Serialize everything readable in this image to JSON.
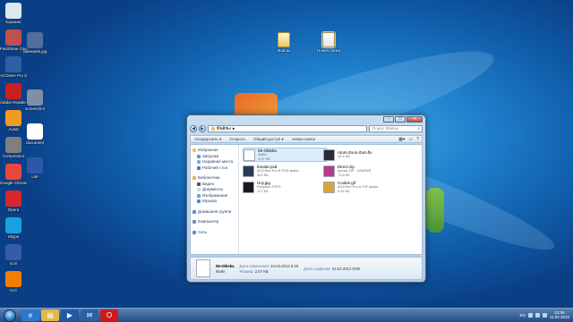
{
  "desktop_icons": [
    {
      "label": "Корзина",
      "color": "#dce7f1"
    },
    {
      "label": "FastStone Capture",
      "color": "#c0504d"
    },
    {
      "label": "ACDSee Pro 8",
      "color": "#2e5fa3"
    },
    {
      "label": "Adobe Reader XI",
      "color": "#c82020"
    },
    {
      "label": "Avast",
      "color": "#f29a1e"
    },
    {
      "label": "Compressor",
      "color": "#7f7f7f"
    },
    {
      "label": "Google Chrome",
      "color": "#e8473b"
    },
    {
      "label": "Opera",
      "color": "#d7262d"
    },
    {
      "label": "Skype",
      "color": "#1aa0e0"
    },
    {
      "label": "Icon",
      "color": "#355ba8"
    },
    {
      "label": "VLC",
      "color": "#f07f00"
    }
  ],
  "desktop_icons_col2": [
    {
      "label": "sideswitle.jpg",
      "color": "#4f6f9f"
    },
    {
      "label": "screenshot",
      "color": "#7f8fa7"
    },
    {
      "label": "document",
      "color": "#ffffff"
    },
    {
      "label": "Lite",
      "color": "#2d58a7"
    }
  ],
  "desktop_folders": [
    {
      "label": "Файлы",
      "selected": false
    },
    {
      "label": "Новая папка",
      "selected": true
    }
  ],
  "window": {
    "address": "Файлы",
    "search_placeholder": "Поиск: Файлы",
    "toolbar": [
      "Упорядочить ▾",
      "Открыть",
      "Общий доступ ▾",
      "Новая папка"
    ],
    "nav": {
      "favorites": {
        "title": "Избранное",
        "items": [
          "Загрузки",
          "Недавние места",
          "Рабочий стол"
        ]
      },
      "libraries": {
        "title": "Библиотеки",
        "items": [
          "Видео",
          "Документы",
          "Изображения",
          "Музыка"
        ]
      },
      "homegroup": "Домашняя группа",
      "computer": "Компьютер",
      "network": "Сеть"
    },
    "files": [
      {
        "name": "06-Obleka",
        "type": "Файл",
        "size": "2,57 КБ",
        "thumb": "#ffffff",
        "selected": true
      },
      {
        "name": "Atom-Zoon-Zum.flv",
        "type": "",
        "size": "10,9 КБ",
        "thumb": "#2a2a3a",
        "selected": false
      },
      {
        "name": "bonder.psd",
        "type": "ACDSee Pro 8 PSD файл",
        "size": "302 КБ",
        "thumb": "#2b3a55",
        "selected": false
      },
      {
        "name": "Direct.zip",
        "type": "Архив ZIP - WinRAR",
        "size": "73,8 КБ",
        "thumb": "#b43c8a",
        "selected": false
      },
      {
        "name": "Hoy.jpg",
        "type": "Рисунок JPEG",
        "size": "127 КБ",
        "thumb": "#1a1a1a",
        "selected": false
      },
      {
        "name": "Cookie.gif",
        "type": "ACDSee Pro 8 GIF файл",
        "size": "9,42 КБ",
        "thumb": "#d9a53a",
        "selected": false
      }
    ],
    "details": {
      "name": "06-Obleka",
      "type": "Файл",
      "modified_key": "Дата изменения:",
      "modified": "24.04.2012 9:19",
      "size_key": "Размер:",
      "size": "2,57 КБ",
      "created_key": "Дата создания:",
      "created": "24.04.2012 9:09"
    }
  },
  "taskbar": {
    "apps": [
      {
        "name": "ie",
        "glyph": "e",
        "color": "#2b79c8"
      },
      {
        "name": "explorer",
        "glyph": "▤",
        "color": "#e1b84a"
      },
      {
        "name": "media",
        "glyph": "▶",
        "color": "#1f5aa6"
      },
      {
        "name": "mail",
        "glyph": "✉",
        "color": "#2960a9"
      },
      {
        "name": "opera",
        "glyph": "O",
        "color": "#cc1b1b"
      }
    ],
    "lang": "EN",
    "time": "13:38",
    "date": "11.02.2015"
  }
}
